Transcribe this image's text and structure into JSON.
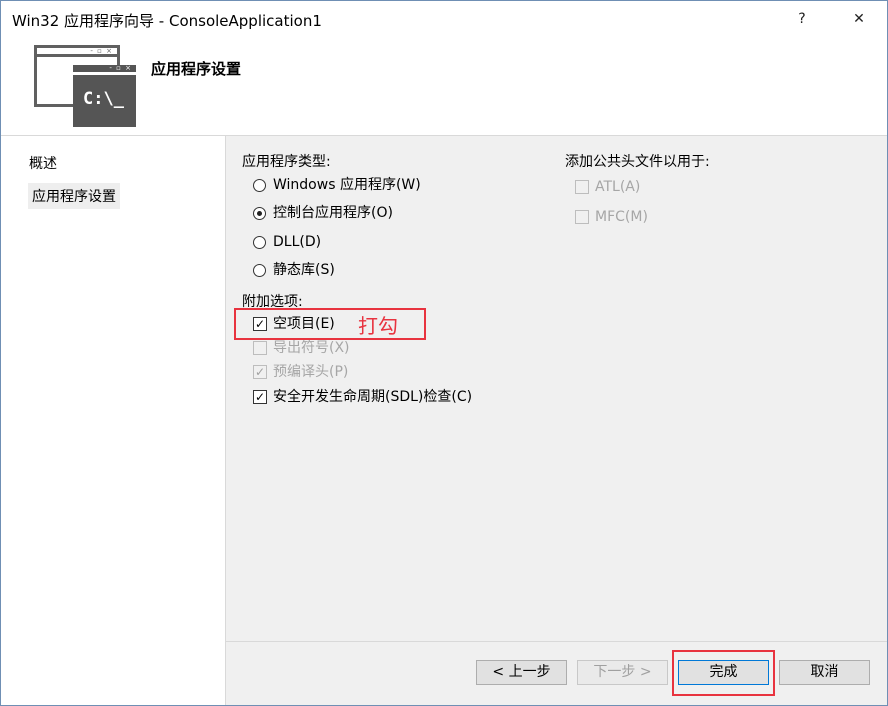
{
  "window": {
    "title": "Win32 应用程序向导 - ConsoleApplication1",
    "help_label": "?",
    "close_label": "✕"
  },
  "header": {
    "title": "应用程序设置",
    "icon_text": "C:\\_",
    "icon_dots": "- ▫ ×"
  },
  "nav": {
    "items": [
      {
        "label": "概述"
      },
      {
        "label": "应用程序设置"
      }
    ]
  },
  "app_type": {
    "label": "应用程序类型:",
    "options": [
      {
        "label": "Windows 应用程序(W)",
        "selected": false
      },
      {
        "label": "控制台应用程序(O)",
        "selected": true
      },
      {
        "label": "DLL(D)",
        "selected": false
      },
      {
        "label": "静态库(S)",
        "selected": false
      }
    ]
  },
  "extra_options": {
    "label": "附加选项:",
    "items": [
      {
        "label": "空项目(E)",
        "checked": true,
        "enabled": true
      },
      {
        "label": "导出符号(X)",
        "checked": false,
        "enabled": false
      },
      {
        "label": "预编译头(P)",
        "checked": true,
        "enabled": false
      },
      {
        "label": "安全开发生命周期(SDL)检查(C)",
        "checked": true,
        "enabled": true
      }
    ]
  },
  "common_headers": {
    "label": "添加公共头文件以用于:",
    "items": [
      {
        "label": "ATL(A)",
        "checked": false,
        "enabled": false
      },
      {
        "label": "MFC(M)",
        "checked": false,
        "enabled": false
      }
    ]
  },
  "annotation": {
    "text": "打勾",
    "color": "#e8333f"
  },
  "buttons": {
    "prev": "< 上一步",
    "next": "下一步 >",
    "finish": "完成",
    "cancel": "取消"
  }
}
